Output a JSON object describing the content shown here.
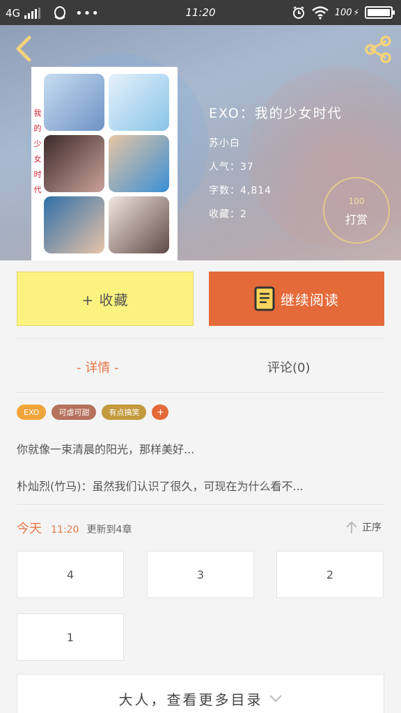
{
  "status_bar": {
    "network": "4G",
    "time": "11:20",
    "battery": "100",
    "battery_level": 1.0
  },
  "book": {
    "title": "EXO：我的少女时代",
    "author": "苏小白",
    "popularity": "人气：37",
    "word_count": "字数：4,814",
    "favorites": "收藏：2",
    "cover_side_text": [
      "我",
      "的",
      "少",
      "女",
      "时",
      "代"
    ]
  },
  "reward": {
    "amount": "100",
    "label": "打赏"
  },
  "actions": {
    "favorite_label": "+ 收藏",
    "continue_label": "继续阅读"
  },
  "tabs": {
    "detail": "- 详情 -",
    "comments": "评论(0)"
  },
  "tags": [
    {
      "label": "EXO",
      "color": "#f0a53a"
    },
    {
      "label": "可虐可甜",
      "color": "#b5715c"
    },
    {
      "label": "有点搞笑",
      "color": "#c39a3d"
    }
  ],
  "tag_add": "+",
  "description": {
    "line1": "你就像一束清晨的阳光，那样美好...",
    "line2": "朴灿烈(竹马)：虽然我们认识了很久，可现在为什么看不..."
  },
  "update": {
    "today": "今天",
    "time": "11:20",
    "info": "更新到4章",
    "sort_label": "正序"
  },
  "chapters": [
    "4",
    "3",
    "2",
    "1"
  ],
  "more_label": "大人，查看更多目录",
  "colors": {
    "accent": "#e46a3a",
    "favorite_bg": "#fbf27f",
    "tab_active": "#e5784a"
  }
}
